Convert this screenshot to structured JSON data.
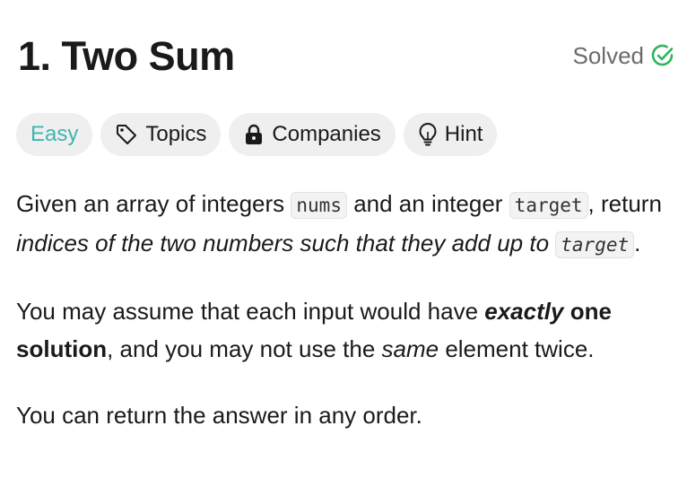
{
  "problem": {
    "title": "1. Two Sum",
    "status": "Solved"
  },
  "tags": {
    "difficulty": "Easy",
    "topics": "Topics",
    "companies": "Companies",
    "hint": "Hint"
  },
  "description": {
    "p1": {
      "t1": "Given an array of integers ",
      "c1": "nums",
      "t2": " and an integer ",
      "c2": "target",
      "t3": ", return ",
      "em1": "indices of the two numbers such that they add up to",
      "t4": " ",
      "c3": "target",
      "t5": "."
    },
    "p2": {
      "t1": "You may assume that each input would have ",
      "bi1": "exactly",
      "t2": " ",
      "b1": "one solution",
      "t3": ", and you may not use the ",
      "em1": "same",
      "t4": " element twice."
    },
    "p3": "You can return the answer in any order."
  },
  "colors": {
    "easy": "#3fb5b0",
    "solved_check": "#2db55d",
    "pill_bg": "#efefef"
  },
  "icons": [
    "solved-check-icon",
    "tag-icon",
    "lock-icon",
    "lightbulb-icon"
  ]
}
